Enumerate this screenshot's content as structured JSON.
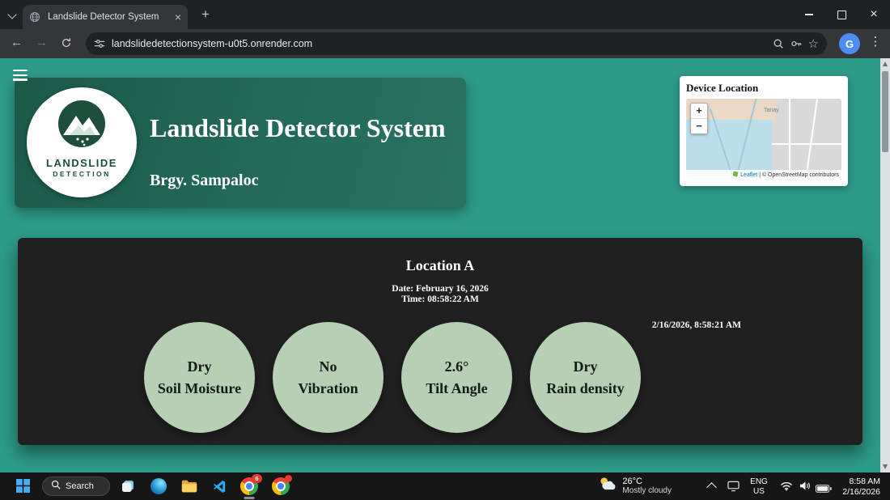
{
  "browser": {
    "tab_title": "Landslide Detector System",
    "url": "landslidedetectionsystem-u0t5.onrender.com",
    "avatar_letter": "G"
  },
  "icons": {
    "back": "←",
    "forward": "→",
    "star": "☆",
    "more": "⋮",
    "close": "×",
    "new_tab": "+",
    "zoom_in": "+",
    "zoom_out": "−"
  },
  "page": {
    "header": {
      "title": "Landslide Detector System",
      "subtitle": "Brgy. Sampaloc",
      "logo": {
        "line1": "LANDSLIDE",
        "line2": "DETECTION"
      }
    },
    "map_card": {
      "title": "Device Location",
      "place_label": "Tanay",
      "attribution_leaflet": "Leaflet",
      "attribution_rest": "| © OpenStreetMap contributors"
    },
    "panel": {
      "location": "Location A",
      "date_line": "Date: February 16, 2026",
      "time_line": "Time: 08:58:22 AM",
      "timestamp": "2/16/2026, 8:58:21 AM",
      "sensors": [
        {
          "value": "Dry",
          "label": "Soil Moisture"
        },
        {
          "value": "No",
          "label": "Vibration"
        },
        {
          "value": "2.6°",
          "label": "Tilt Angle"
        },
        {
          "value": "Dry",
          "label": "Rain density"
        }
      ]
    }
  },
  "taskbar": {
    "search_label": "Search",
    "chrome_badge": "6",
    "weather": {
      "temp": "26°C",
      "condition": "Mostly cloudy"
    },
    "language": {
      "line1": "ENG",
      "line2": "US"
    },
    "clock": {
      "time": "8:58 AM",
      "date": "2/16/2026"
    }
  },
  "colors": {
    "page_bg": "#2d9a89",
    "header_card": "#1c5949",
    "panel_bg": "#202020",
    "sensor_circle": "#b7cfb4",
    "accent_blue": "#4285f4",
    "badge_red": "#e53935"
  }
}
